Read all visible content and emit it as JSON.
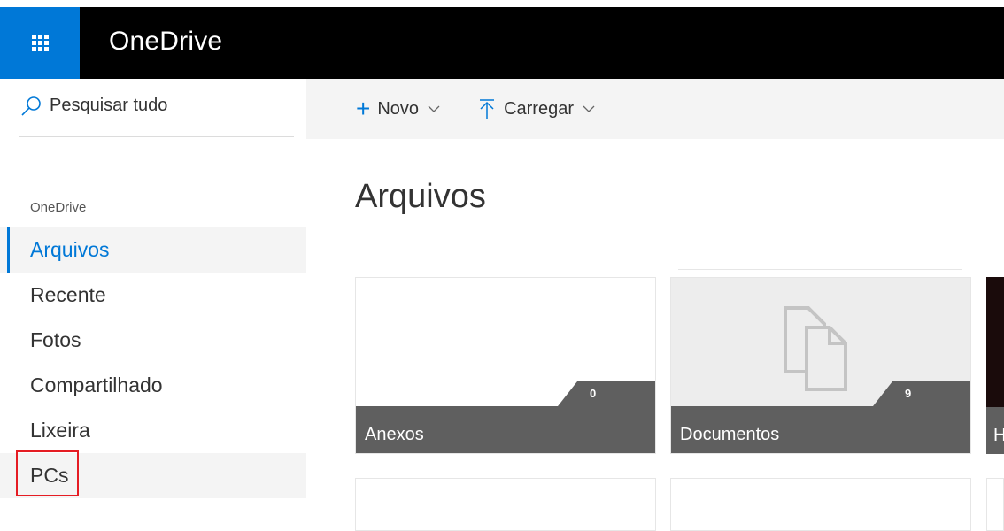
{
  "header": {
    "app_title": "OneDrive",
    "launcher_icon": "waffle-icon"
  },
  "sidebar": {
    "search_label": "Pesquisar tudo",
    "section_label": "OneDrive",
    "items": [
      {
        "label": "Arquivos",
        "active": true
      },
      {
        "label": "Recente"
      },
      {
        "label": "Fotos"
      },
      {
        "label": "Compartilhado"
      },
      {
        "label": "Lixeira"
      },
      {
        "label": "PCs",
        "highlighted": true
      }
    ]
  },
  "toolbar": {
    "new_label": "Novo",
    "upload_label": "Carregar"
  },
  "main": {
    "title": "Arquivos",
    "folders": [
      {
        "name": "Anexos",
        "count": "0"
      },
      {
        "name": "Documentos",
        "count": "9"
      },
      {
        "name": "H"
      }
    ]
  },
  "colors": {
    "accent": "#0078d7",
    "header_bg": "#000000",
    "tile_footer": "#5f5f5f",
    "highlight": "#e51c23"
  }
}
